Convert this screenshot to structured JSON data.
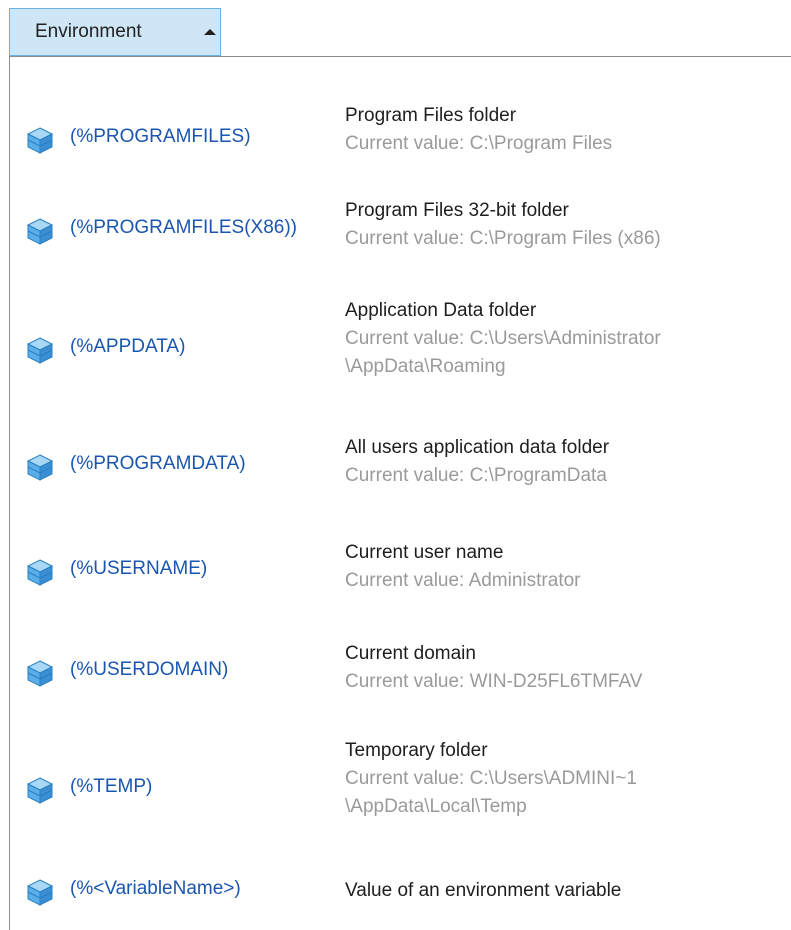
{
  "dropdown": {
    "label": "Environment"
  },
  "items": [
    {
      "variable": "(%PROGRAMFILES)",
      "description": "Program Files folder",
      "current": "Current value: C:\\Program Files",
      "current2": ""
    },
    {
      "variable": "(%PROGRAMFILES(X86))",
      "description": "Program Files 32-bit folder",
      "current": "Current value: C:\\Program Files (x86)",
      "current2": ""
    },
    {
      "variable": "(%APPDATA)",
      "description": "Application Data folder",
      "current": "Current value: C:\\Users\\Administrator",
      "current2": "\\AppData\\Roaming"
    },
    {
      "variable": "(%PROGRAMDATA)",
      "description": "All users application data folder",
      "current": "Current value: C:\\ProgramData",
      "current2": ""
    },
    {
      "variable": "(%USERNAME)",
      "description": "Current user name",
      "current": "Current value: Administrator",
      "current2": ""
    },
    {
      "variable": "(%USERDOMAIN)",
      "description": "Current domain",
      "current": "Current value: WIN-D25FL6TMFAV",
      "current2": ""
    },
    {
      "variable": "(%TEMP)",
      "description": "Temporary folder",
      "current": "Current value: C:\\Users\\ADMINI~1",
      "current2": "\\AppData\\Local\\Temp"
    },
    {
      "variable": "(%<VariableName>)",
      "description": "Value of an environment variable",
      "current": "",
      "current2": ""
    }
  ],
  "icons": {
    "item_icon": "cube-icon",
    "dropdown_icon": "caret-up-icon"
  },
  "colors": {
    "variable_text": "#1a56b0",
    "description_text": "#1e1e1e",
    "current_value_text": "#9a9a9a",
    "dropdown_bg": "#cfe6f7",
    "dropdown_border": "#6fb0e0"
  }
}
